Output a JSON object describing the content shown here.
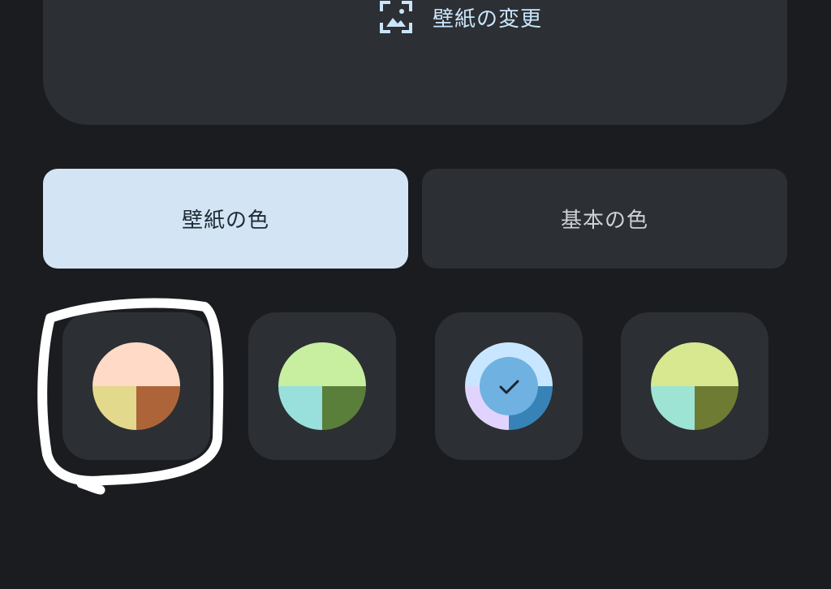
{
  "wallpaper_section": {
    "change_label": "壁紙の変更",
    "icon": "wallpaper-image-icon",
    "accent_color": "#c9e5fb"
  },
  "tabs": [
    {
      "label": "壁紙の色",
      "selected": true
    },
    {
      "label": "基本の色",
      "selected": false
    }
  ],
  "swatches": [
    {
      "top": "#ffdac6",
      "bottom_left": "#e2d98c",
      "bottom_right": "#ae6439",
      "selected": false,
      "highlighted": true
    },
    {
      "top": "#c8eea0",
      "bottom_left": "#99e0dc",
      "bottom_right": "#5a7f3b",
      "selected": false
    },
    {
      "top": "#c8e6ff",
      "bottom_left": "#e0d4ff",
      "bottom_right": "#3783b7",
      "center": "#6fb1e0",
      "selected": true,
      "icon": "check-icon"
    },
    {
      "top": "#d7e890",
      "bottom_left": "#9de4d4",
      "bottom_right": "#6e7c33",
      "selected": false
    }
  ],
  "colors": {
    "background": "#1a1c1f",
    "card": "#2c2f33",
    "selected_tab": "#d3e5f5"
  }
}
